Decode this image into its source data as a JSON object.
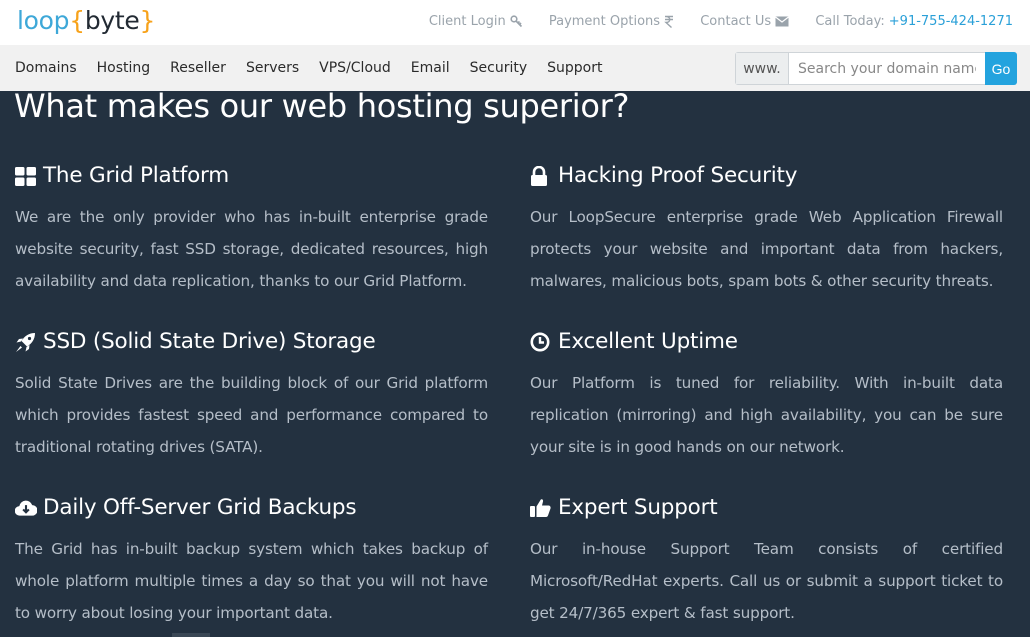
{
  "brand": {
    "part1": "loop",
    "open": "{",
    "part2": "byte",
    "close": "}"
  },
  "toplinks": {
    "client_login": "Client Login",
    "payment_options": "Payment Options",
    "contact_us": "Contact Us",
    "call_label": "Call Today:",
    "phone": "+91-755-424-1271"
  },
  "nav": [
    "Domains",
    "Hosting",
    "Reseller",
    "Servers",
    "VPS/Cloud",
    "Email",
    "Security",
    "Support"
  ],
  "search": {
    "prefix": "www.",
    "placeholder": "Search your domain name",
    "button": "Go"
  },
  "headline": "What makes our web hosting superior?",
  "features": [
    {
      "icon": "grid-icon",
      "title": "The Grid Platform",
      "text": "We are the only provider who has in-built enterprise grade website security, fast SSD storage, dedicated resources, high availability and data replication, thanks to our Grid Platform."
    },
    {
      "icon": "lock-icon",
      "title": "Hacking Proof Security",
      "text": "Our LoopSecure enterprise grade Web Application Firewall protects your website and important data from hackers, malwares, malicious bots, spam bots & other security threats."
    },
    {
      "icon": "rocket-icon",
      "title": "SSD (Solid State Drive) Storage",
      "text": "Solid State Drives are the building block of our Grid platform which provides fastest speed and performance compared to traditional rotating drives (SATA)."
    },
    {
      "icon": "clock-icon",
      "title": "Excellent Uptime",
      "text": "Our Platform is tuned for reliability. With in-built data replication (mirroring) and high availability, you can be sure your site is in good hands on our network."
    },
    {
      "icon": "cloud-download-icon",
      "title": "Daily Off-Server Grid Backups",
      "text": "The Grid has in-built backup system which takes backup of whole platform multiple times a day so that you will not have to worry about losing your important data."
    },
    {
      "icon": "thumbs-up-icon",
      "title": "Expert Support",
      "text": "Our in-house Support Team consists of certified Microsoft/RedHat experts. Call us or submit a support ticket to get 24/7/365 expert & fast support."
    }
  ]
}
